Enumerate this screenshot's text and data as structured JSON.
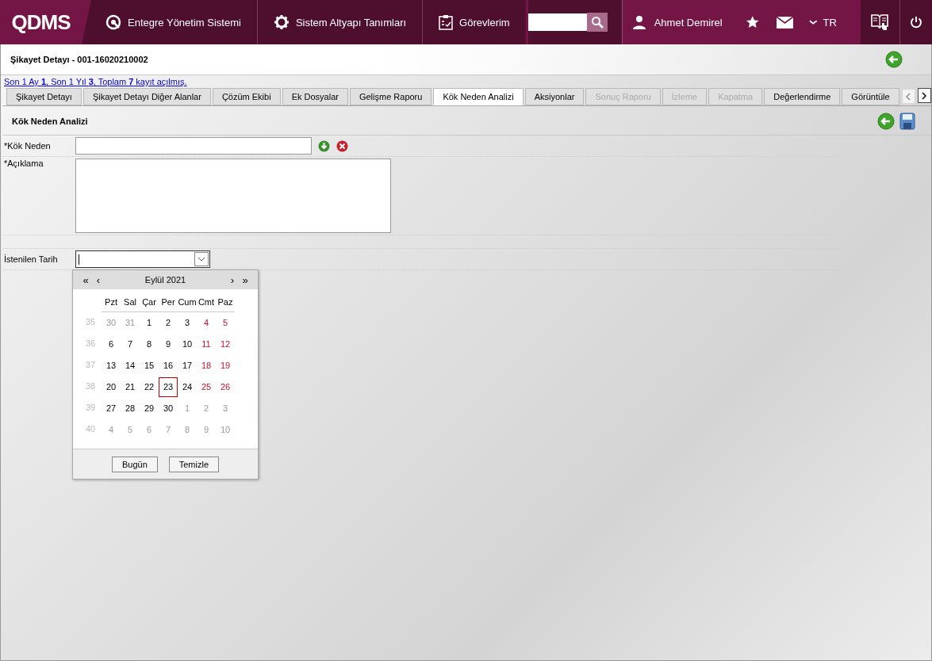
{
  "header": {
    "logo": "QDMS",
    "nav": [
      {
        "label": "Entegre Yönetim Sistemi",
        "kind": "q"
      },
      {
        "label": "Sistem Altyapı Tanımları",
        "kind": "gear"
      },
      {
        "label": "Görevlerim",
        "kind": "clipboard"
      }
    ],
    "user": "Ahmet Demirel",
    "language": "TR"
  },
  "page_title": "Şikayet Detayı - 001-16020210002",
  "info_link": "Son 1 Ay **1**, Son 1 Yıl **3**, Toplam **7** kayıt açılmış.",
  "tabs": [
    {
      "label": "Şikayet Detayı",
      "selected": false,
      "disabled": false
    },
    {
      "label": "Şikayet Detayı Diğer Alanlar",
      "selected": false,
      "disabled": false
    },
    {
      "label": "Çözüm Ekibi",
      "selected": false,
      "disabled": false
    },
    {
      "label": "Ek Dosyalar",
      "selected": false,
      "disabled": false
    },
    {
      "label": "Gelişme Raporu",
      "selected": false,
      "disabled": false
    },
    {
      "label": "Kök Neden Analizi",
      "selected": true,
      "disabled": false
    },
    {
      "label": "Aksiyonlar",
      "selected": false,
      "disabled": false
    },
    {
      "label": "Sonuç Raporu",
      "selected": false,
      "disabled": true
    },
    {
      "label": "İzleme",
      "selected": false,
      "disabled": true
    },
    {
      "label": "Kapatma",
      "selected": false,
      "disabled": true
    },
    {
      "label": "Değerlendirme",
      "selected": false,
      "disabled": false
    },
    {
      "label": "Görüntüle",
      "selected": false,
      "disabled": false
    }
  ],
  "section_title": "Kök Neden Analizi",
  "form": {
    "root_cause_label": "*Kök Neden",
    "description_label": "*Açıklama",
    "date_label": "İstenilen Tarih"
  },
  "calendar": {
    "month": "Eylül 2021",
    "prev_year": "«",
    "prev_month": "‹",
    "next_month": "›",
    "next_year": "»",
    "weekdays": [
      "Pzt",
      "Sal",
      "Çar",
      "Per",
      "Cum",
      "Cmt",
      "Paz"
    ],
    "weeks": [
      {
        "number": "35",
        "days": [
          {
            "d": "30",
            "kind": "other",
            "selected": false
          },
          {
            "d": "31",
            "kind": "other",
            "selected": false
          },
          {
            "d": "1",
            "kind": "day",
            "selected": false
          },
          {
            "d": "2",
            "kind": "day",
            "selected": false
          },
          {
            "d": "3",
            "kind": "day",
            "selected": false
          },
          {
            "d": "4",
            "kind": "weekend",
            "selected": false
          },
          {
            "d": "5",
            "kind": "weekend",
            "selected": false
          }
        ]
      },
      {
        "number": "36",
        "days": [
          {
            "d": "6",
            "kind": "day",
            "selected": false
          },
          {
            "d": "7",
            "kind": "day",
            "selected": false
          },
          {
            "d": "8",
            "kind": "day",
            "selected": false
          },
          {
            "d": "9",
            "kind": "day",
            "selected": false
          },
          {
            "d": "10",
            "kind": "day",
            "selected": false
          },
          {
            "d": "11",
            "kind": "weekend",
            "selected": false
          },
          {
            "d": "12",
            "kind": "weekend",
            "selected": false
          }
        ]
      },
      {
        "number": "37",
        "days": [
          {
            "d": "13",
            "kind": "day",
            "selected": false
          },
          {
            "d": "14",
            "kind": "day",
            "selected": false
          },
          {
            "d": "15",
            "kind": "day",
            "selected": false
          },
          {
            "d": "16",
            "kind": "day",
            "selected": false
          },
          {
            "d": "17",
            "kind": "day",
            "selected": false
          },
          {
            "d": "18",
            "kind": "weekend",
            "selected": false
          },
          {
            "d": "19",
            "kind": "weekend",
            "selected": false
          }
        ]
      },
      {
        "number": "38",
        "days": [
          {
            "d": "20",
            "kind": "day",
            "selected": false
          },
          {
            "d": "21",
            "kind": "day",
            "selected": false
          },
          {
            "d": "22",
            "kind": "day",
            "selected": false
          },
          {
            "d": "23",
            "kind": "day",
            "selected": true
          },
          {
            "d": "24",
            "kind": "day",
            "selected": false
          },
          {
            "d": "25",
            "kind": "weekend",
            "selected": false
          },
          {
            "d": "26",
            "kind": "weekend",
            "selected": false
          }
        ]
      },
      {
        "number": "39",
        "days": [
          {
            "d": "27",
            "kind": "day",
            "selected": false
          },
          {
            "d": "28",
            "kind": "day",
            "selected": false
          },
          {
            "d": "29",
            "kind": "day",
            "selected": false
          },
          {
            "d": "30",
            "kind": "day",
            "selected": false
          },
          {
            "d": "1",
            "kind": "other",
            "selected": false
          },
          {
            "d": "2",
            "kind": "other",
            "selected": false
          },
          {
            "d": "3",
            "kind": "other",
            "selected": false
          }
        ]
      },
      {
        "number": "40",
        "days": [
          {
            "d": "4",
            "kind": "other",
            "selected": false
          },
          {
            "d": "5",
            "kind": "other",
            "selected": false
          },
          {
            "d": "6",
            "kind": "other",
            "selected": false
          },
          {
            "d": "7",
            "kind": "other",
            "selected": false
          },
          {
            "d": "8",
            "kind": "other",
            "selected": false
          },
          {
            "d": "9",
            "kind": "other",
            "selected": false
          },
          {
            "d": "10",
            "kind": "other",
            "selected": false
          }
        ]
      }
    ],
    "buttons": [
      "Bugün",
      "Temizle"
    ]
  }
}
